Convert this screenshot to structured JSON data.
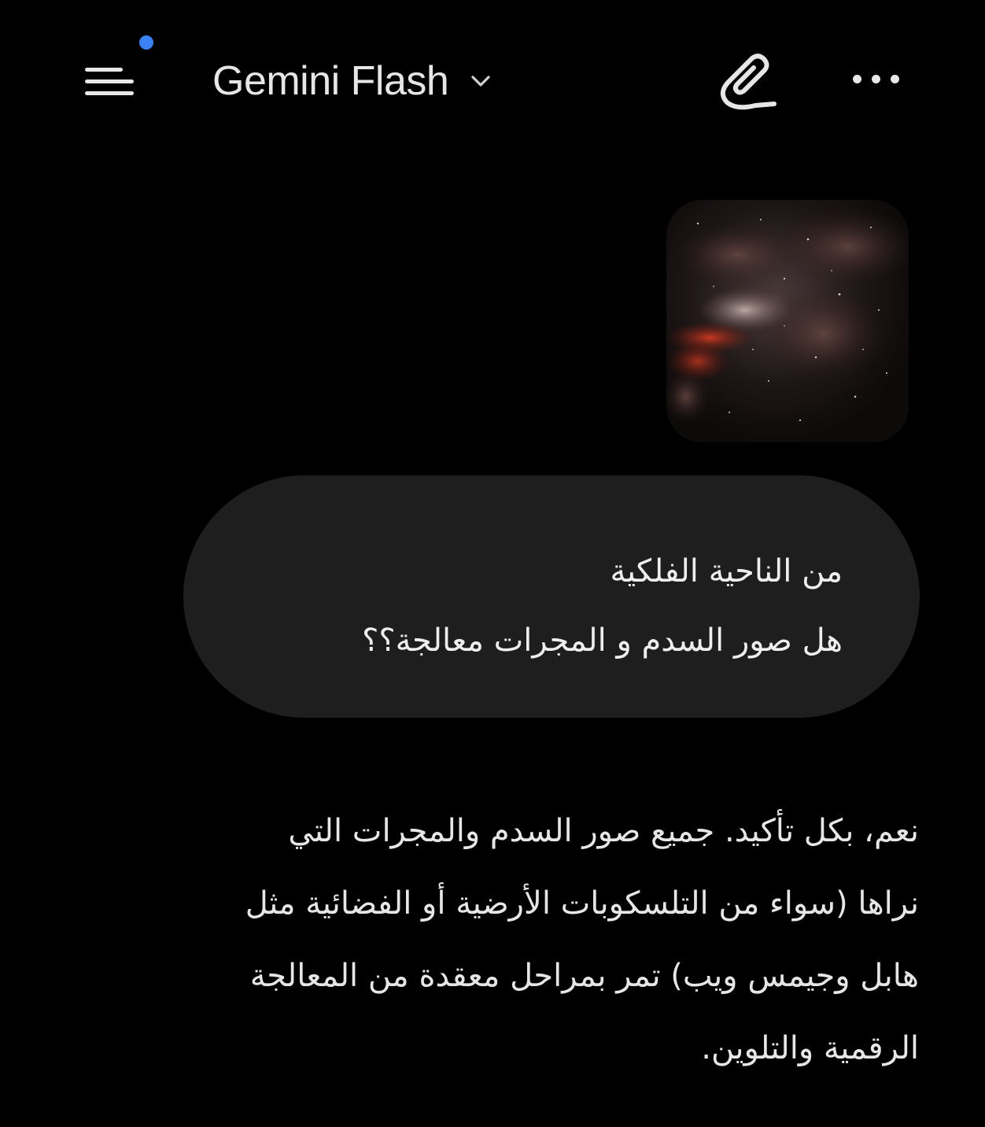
{
  "header": {
    "model_name": "Gemini Flash",
    "menu_icon": "menu-icon",
    "notification_dot_color": "#3b82f6",
    "model_dropdown_icon": "chevron-down-icon",
    "new_chat_icon": "edit-pen-icon",
    "more_icon": "more-horizontal-icon"
  },
  "conversation": {
    "user_message": {
      "attachment_icon": "image-thumbnail-nebula",
      "lines": [
        "من الناحية الفلكية",
        "هل صور السدم و المجرات معالجة؟؟"
      ]
    },
    "model_reply": {
      "lines": [
        "نعم، بكل تأكيد. جميع صور السدم والمجرات التي",
        "نراها (سواء من التلسكوبات الأرضية أو الفضائية مثل",
        "هابل وجيمس ويب) تمر بمراحل معقدة من المعالجة",
        "الرقمية والتلوين."
      ]
    }
  },
  "colors": {
    "background": "#000000",
    "user_bubble": "#1e1e1e",
    "text": "#e6e6e6"
  }
}
